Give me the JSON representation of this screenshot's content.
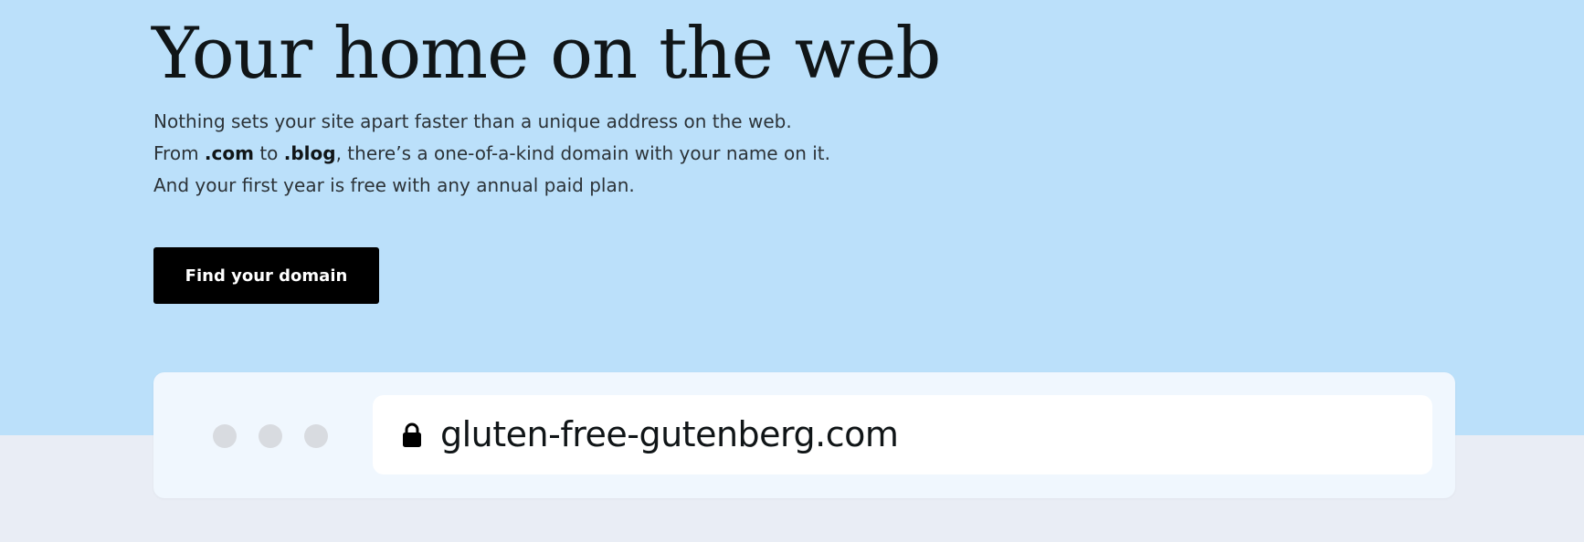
{
  "hero": {
    "title": "Your home on the web",
    "description": {
      "line1": "Nothing sets your site apart faster than a unique address on the web.",
      "line2_prefix": "From ",
      "line2_tld1": ".com",
      "line2_middle": " to ",
      "line2_tld2": ".blog",
      "line2_suffix": ", there’s a one-of-a-kind domain with your name on it.",
      "line3": "And your first year is free with any annual paid plan."
    },
    "cta_label": "Find your domain"
  },
  "browser_mock": {
    "window_dots": [
      "dot",
      "dot",
      "dot"
    ],
    "icon": "lock-icon",
    "address": "gluten-free-gutenberg.com"
  },
  "colors": {
    "hero_background": "#bbe0fa",
    "page_background": "#e9edf5",
    "button_background": "#000000",
    "card_background": "#f0f7fe",
    "dot_color": "#d8dbe0"
  }
}
